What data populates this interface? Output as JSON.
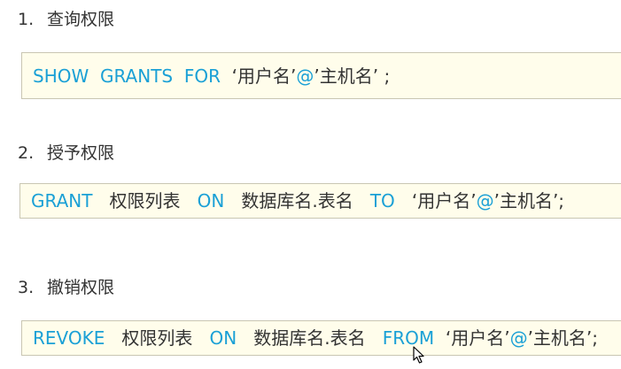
{
  "sections": [
    {
      "number": "1.",
      "title": "查询权限",
      "code": [
        {
          "t": "SHOW  GRANTS  FOR",
          "kw": true
        },
        {
          "t": "  ‘用户名’",
          "kw": false
        },
        {
          "t": "@",
          "kw": true
        },
        {
          "t": "’主机名’ ;",
          "kw": false
        }
      ]
    },
    {
      "number": "2.",
      "title": "授予权限",
      "code": [
        {
          "t": "GRANT",
          "kw": true
        },
        {
          "t": "   权限列表   ",
          "kw": false
        },
        {
          "t": "ON",
          "kw": true
        },
        {
          "t": "   数据库名.表名   ",
          "kw": false
        },
        {
          "t": "TO",
          "kw": true
        },
        {
          "t": "   ‘用户名’",
          "kw": false
        },
        {
          "t": "@",
          "kw": true
        },
        {
          "t": "’主机名’;",
          "kw": false
        }
      ]
    },
    {
      "number": "3.",
      "title": "撤销权限",
      "code": [
        {
          "t": "REVOKE",
          "kw": true
        },
        {
          "t": "   权限列表   ",
          "kw": false
        },
        {
          "t": "ON",
          "kw": true
        },
        {
          "t": "   数据库名.表名   ",
          "kw": false
        },
        {
          "t": "FROM",
          "kw": true
        },
        {
          "t": "  ‘用户名’",
          "kw": false
        },
        {
          "t": "@",
          "kw": true
        },
        {
          "t": "’主机名’;",
          "kw": false
        }
      ]
    }
  ],
  "colors": {
    "keyword": "#1aa0d6",
    "text": "#333333",
    "code_background": "#fffdeb",
    "code_border": "#c9c6b2"
  },
  "cursor_icon": "mouse-pointer-icon"
}
